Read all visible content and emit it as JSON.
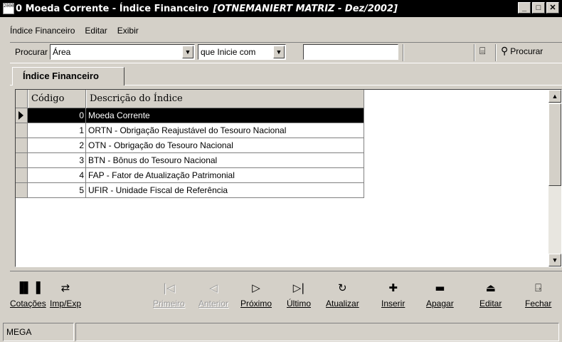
{
  "window": {
    "app_icon": "2000",
    "title_main": "0 Moeda Corrente -  Índice Financeiro",
    "title_context": "[OTNEMANIERT MATRIZ - Dez/2002]",
    "controls": {
      "minimize": "_",
      "maximize": "□",
      "close": "✕"
    }
  },
  "menu": {
    "items": [
      "Índice Financeiro",
      "Editar",
      "Exibir"
    ]
  },
  "search": {
    "label": "Procurar",
    "field_value": "Área",
    "condition_value": "que Inicie com",
    "text_value": "",
    "search_button_label": "Procurar"
  },
  "tabs": {
    "active": "Índice Financeiro"
  },
  "grid": {
    "columns": [
      "Código",
      "Descrição do Índice"
    ],
    "rows": [
      {
        "code": "0",
        "description": "Moeda Corrente",
        "selected": true
      },
      {
        "code": "1",
        "description": "ORTN - Obrigação Reajustável do Tesouro Nacional"
      },
      {
        "code": "2",
        "description": "OTN - Obrigação do Tesouro Nacional"
      },
      {
        "code": "3",
        "description": "BTN - Bônus do Tesouro Nacional"
      },
      {
        "code": "4",
        "description": "FAP - Fator de Atualização Patrimonial"
      },
      {
        "code": "5",
        "description": "UFIR - Unidade Fiscal de Referência"
      }
    ]
  },
  "toolbar": {
    "cotacoes": "Cotações",
    "impexp": "Imp/Exp",
    "primeiro": "Primeiro",
    "anterior": "Anterior",
    "proximo": "Próximo",
    "ultimo": "Último",
    "atualizar": "Atualizar",
    "inserir": "Inserir",
    "apagar": "Apagar",
    "editar": "Editar",
    "fechar": "Fechar"
  },
  "status": {
    "panel1": "MEGA",
    "panel2": ""
  }
}
